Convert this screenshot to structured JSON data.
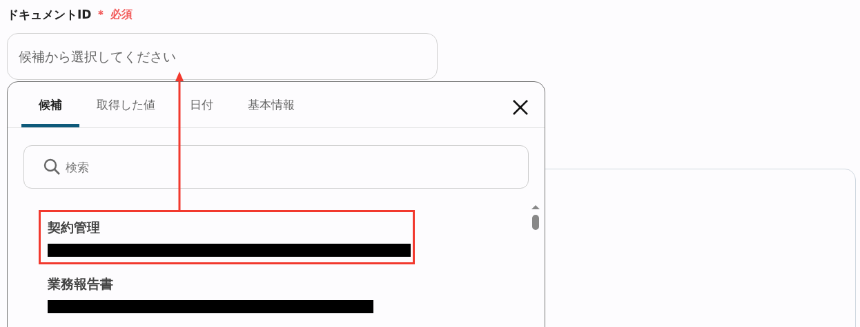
{
  "field": {
    "label": "ドキュメントID",
    "required_mark": "＊",
    "required": "必須",
    "placeholder": "候補から選択してください"
  },
  "popup": {
    "tabs": [
      {
        "label": "候補",
        "selected": true
      },
      {
        "label": "取得した値",
        "selected": false
      },
      {
        "label": "日付",
        "selected": false
      },
      {
        "label": "基本情報",
        "selected": false
      }
    ],
    "search": {
      "placeholder": "検索"
    },
    "items": [
      {
        "title": "契約管理",
        "redacted": true,
        "highlighted": true
      },
      {
        "title": "業務報告書",
        "redacted": true,
        "highlighted": false
      }
    ]
  }
}
